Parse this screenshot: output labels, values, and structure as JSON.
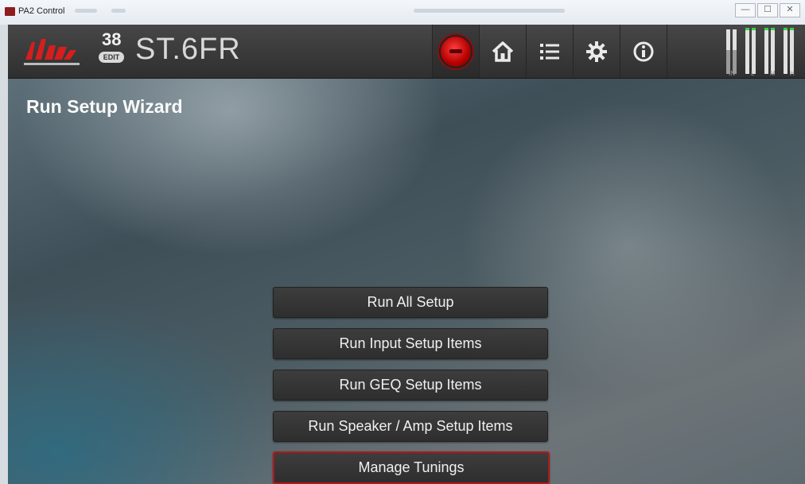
{
  "window": {
    "title": "PA2 Control",
    "controls": [
      "—",
      "☐",
      "✕"
    ]
  },
  "header": {
    "preset_number": "38",
    "edit_label": "EDIT",
    "preset_name": "ST.6FR",
    "nav": [
      {
        "name": "record-button",
        "icon": "record-icon",
        "glyph": ""
      },
      {
        "name": "home-button",
        "icon": "home-icon",
        "glyph": "⌂"
      },
      {
        "name": "list-button",
        "icon": "list-icon",
        "glyph": "☰"
      },
      {
        "name": "settings-button",
        "icon": "gear-icon",
        "glyph": "⚙"
      },
      {
        "name": "info-button",
        "icon": "info-icon",
        "glyph": "ⓘ"
      }
    ],
    "meter_labels": [
      "IN",
      "L",
      "M",
      "H"
    ]
  },
  "page": {
    "title": "Run Setup Wizard"
  },
  "wizard": {
    "buttons": [
      "Run All Setup",
      "Run Input Setup Items",
      "Run GEQ Setup Items",
      "Run Speaker / Amp Setup Items",
      "Manage Tunings"
    ],
    "selected_index": 4
  },
  "colors": {
    "accent_red": "#b01818",
    "header_bg": "#3a3a3a",
    "meter_green": "#39d14a"
  }
}
